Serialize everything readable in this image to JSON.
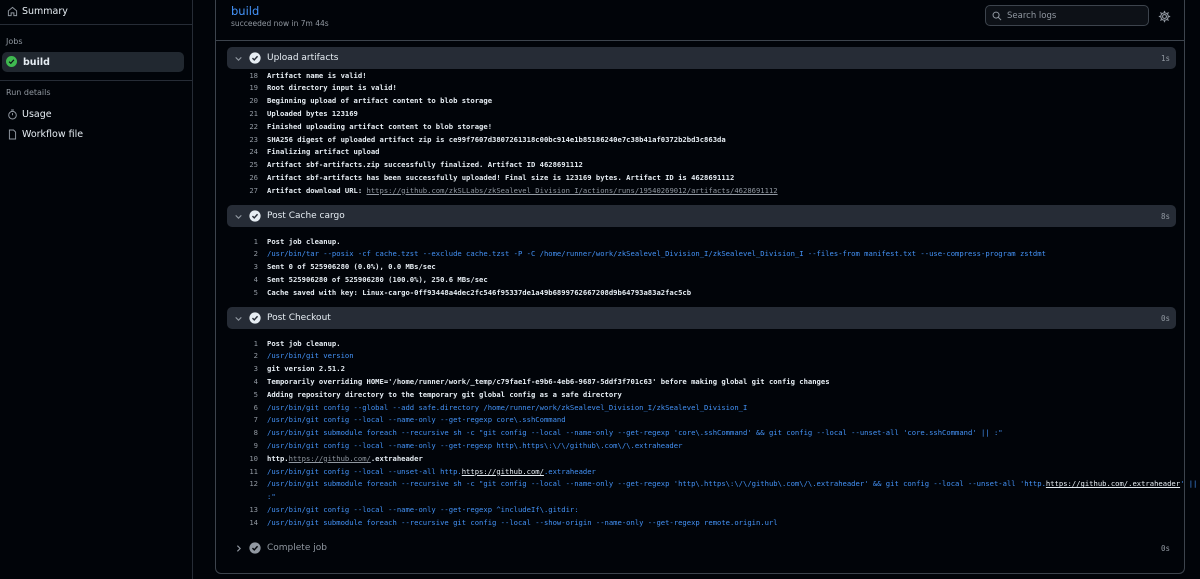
{
  "sidebar": {
    "summary": "Summary",
    "jobs_heading": "Jobs",
    "job": "build",
    "run_details_heading": "Run details",
    "usage": "Usage",
    "workflow_file": "Workflow file"
  },
  "header": {
    "title": "build",
    "status": "succeeded now in 7m 44s",
    "search_placeholder": "Search logs"
  },
  "steps": {
    "upload": {
      "name": "Upload artifacts",
      "duration": "1s",
      "lines": {
        "l18": "Artifact name is valid!",
        "l19": "Root directory input is valid!",
        "l20": "Beginning upload of artifact content to blob storage",
        "l21": "Uploaded bytes 123169",
        "l22": "Finished uploading artifact content to blob storage!",
        "l23": "SHA256 digest of uploaded artifact zip is ce99f7607d3807261318c00bc914e1b85186240e7c38b41af0372b2bd3c863da",
        "l24": "Finalizing artifact upload",
        "l25": "Artifact sbf-artifacts.zip successfully finalized. Artifact ID 4628691112",
        "l26": "Artifact sbf-artifacts has been successfully uploaded! Final size is 123169 bytes. Artifact ID is 4628691112",
        "l27_prefix": "Artifact download URL: ",
        "l27_link": "https://github.com/zkSLLabs/zkSealevel_Division_I/actions/runs/19540269012/artifacts/4628691112"
      }
    },
    "cache": {
      "name": "Post Cache cargo",
      "duration": "8s",
      "lines": {
        "l1": "Post job cleanup.",
        "l2": "/usr/bin/tar --posix -cf cache.tzst --exclude cache.tzst -P -C /home/runner/work/zkSealevel_Division_I/zkSealevel_Division_I --files-from manifest.txt --use-compress-program zstdmt",
        "l3": "Sent 0 of 525906280 (0.0%), 0.0 MBs/sec",
        "l4": "Sent 525906280 of 525906280 (100.0%), 250.6 MBs/sec",
        "l5": "Cache saved with key: Linux-cargo-0ff93448a4dec2fc546f95337de1a49b6899762667208d9b64793a83a2fac5cb"
      }
    },
    "checkout": {
      "name": "Post Checkout",
      "duration": "0s",
      "lines": {
        "l1": "Post job cleanup.",
        "l2": "/usr/bin/git version",
        "l3": "git version 2.51.2",
        "l4": "Temporarily overriding HOME='/home/runner/work/_temp/c79fae1f-e9b6-4eb6-9687-5ddf3f701c63' before making global git config changes",
        "l5": "Adding repository directory to the temporary git global config as a safe directory",
        "l6": "/usr/bin/git config --global --add safe.directory /home/runner/work/zkSealevel_Division_I/zkSealevel_Division_I",
        "l7": "/usr/bin/git config --local --name-only --get-regexp core\\.sshCommand",
        "l8": "/usr/bin/git submodule foreach --recursive sh -c \"git config --local --name-only --get-regexp 'core\\.sshCommand' && git config --local --unset-all 'core.sshCommand' || :\"",
        "l9": "/usr/bin/git config --local --name-only --get-regexp http\\.https\\:\\/\\/github\\.com\\/\\.extraheader",
        "l10_prefix": "http.",
        "l10_link": "https://github.com/",
        "l10_suffix": ".extraheader",
        "l11_prefix": "/usr/bin/git config --local --unset-all http.",
        "l11_link": "https://github.com/",
        "l11_suffix": ".extraheader",
        "l12_prefix": "/usr/bin/git submodule foreach --recursive sh -c \"git config --local --name-only --get-regexp 'http\\.https\\:\\/\\/github\\.com\\/\\.extraheader' && git config --local --unset-all 'http.",
        "l12_link": "https://github.com/.extraheader",
        "l12_suffix": "' ||",
        "l12_wrap": ":\"",
        "l13": "/usr/bin/git config --local --name-only --get-regexp ^includeIf\\.gitdir:",
        "l14": "/usr/bin/git submodule foreach --recursive git config --local --show-origin --name-only --get-regexp remote.origin.url"
      }
    },
    "complete": {
      "name": "Complete job",
      "duration": "0s"
    }
  }
}
